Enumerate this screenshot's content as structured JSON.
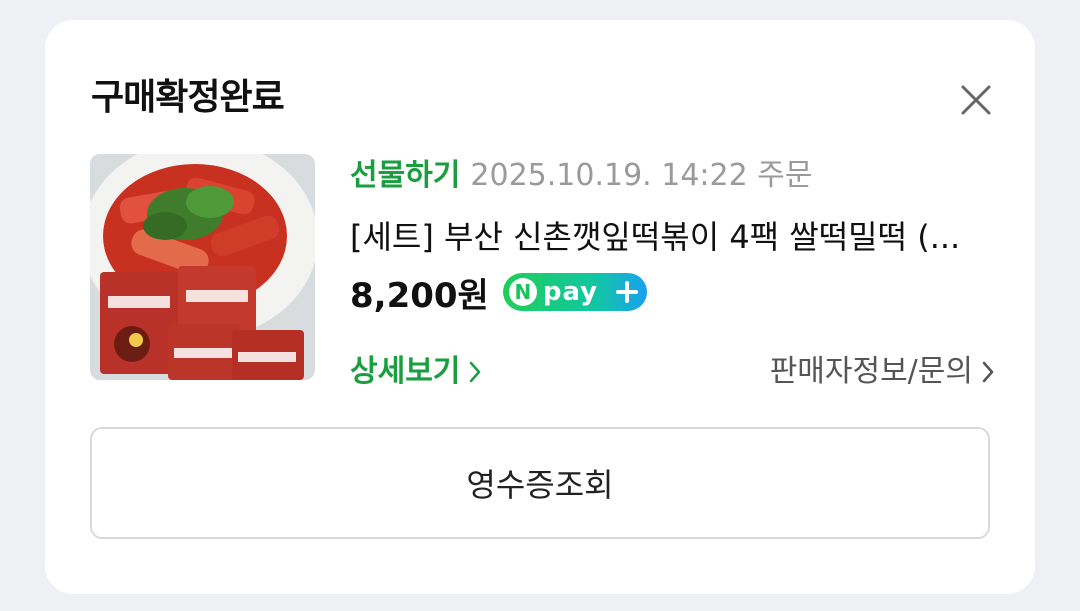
{
  "dialog": {
    "title": "구매확정완료",
    "close_icon": "close-icon"
  },
  "order": {
    "gift_label": "선물하기",
    "order_datetime": "2025.10.19. 14:22 주문",
    "product_name": "[세트] 부산 신촌깻잎떡볶이 4팩 쌀떡밀떡 (...",
    "price": "8,200원",
    "payment_badge": {
      "icon": "npay-n-logo",
      "text": "pay",
      "plus_icon": "plus-icon",
      "colors": [
        "#1fce59",
        "#1aa0f0"
      ]
    },
    "detail_link": "상세보기",
    "seller_link": "판매자정보/문의"
  },
  "receipt_button": "영수증조회",
  "colors": {
    "accent_green": "#1a9e3f",
    "muted_text": "#9a9a9a",
    "background": "#eef0f3"
  }
}
